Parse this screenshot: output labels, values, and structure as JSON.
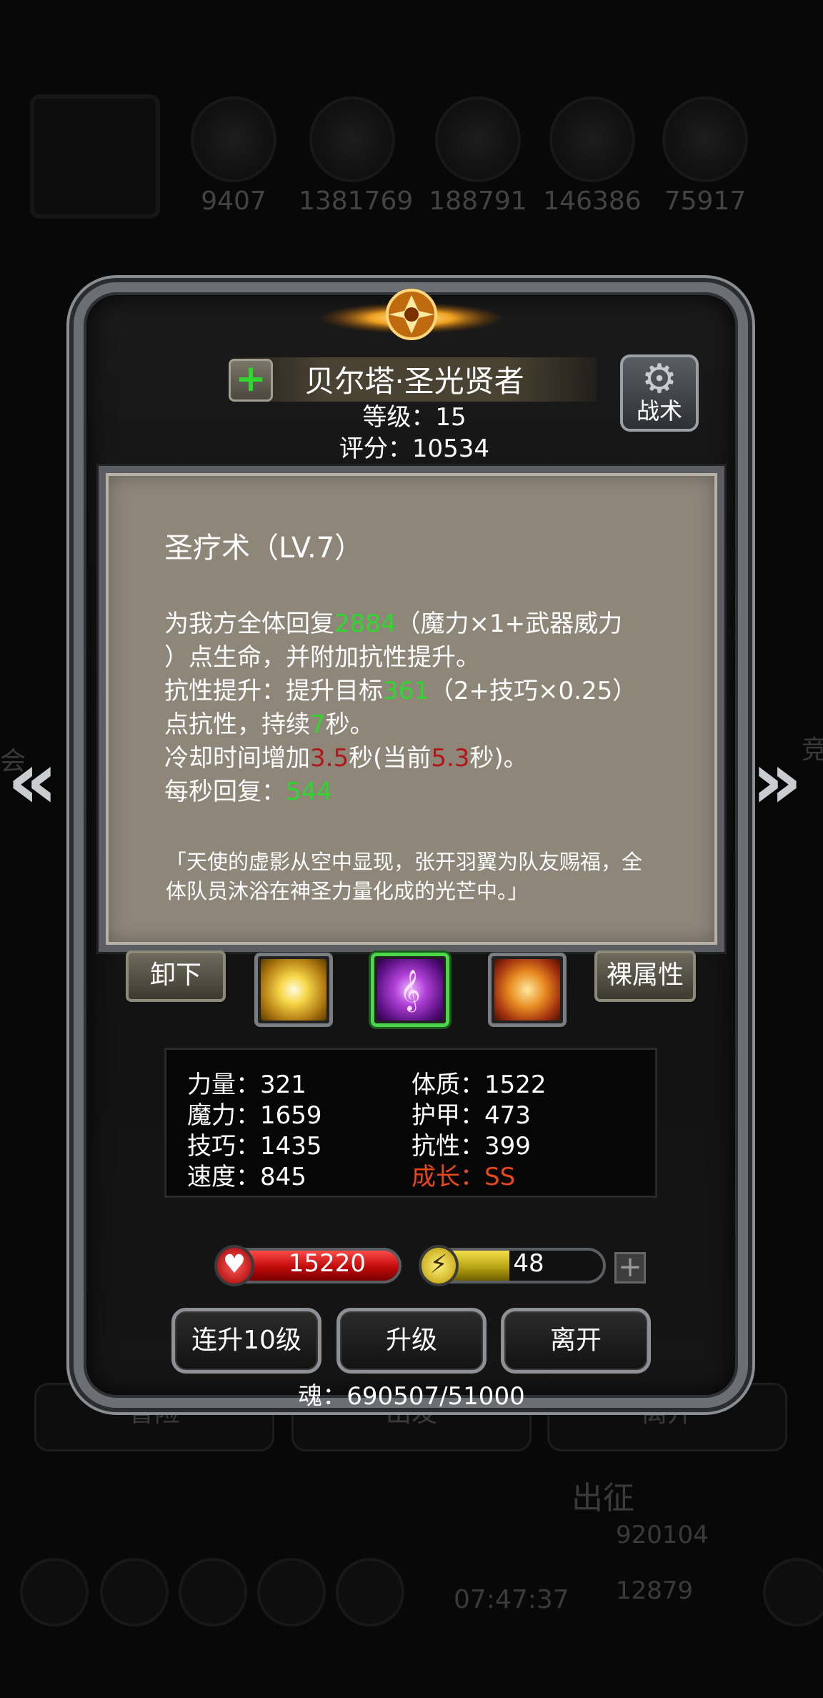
{
  "background": {
    "resources": [
      {
        "value": "9407",
        "icon": "potion-icon"
      },
      {
        "value": "1381769",
        "icon": "wood-icon"
      },
      {
        "value": "188791",
        "icon": "stone-icon"
      },
      {
        "value": "146386",
        "icon": "crystal-icon"
      },
      {
        "value": "75917",
        "icon": "ore-icon"
      }
    ],
    "tabs": [
      "冒险",
      "出发",
      "离开"
    ],
    "expedition_label": "出征",
    "gold": "920104",
    "gems": "12879",
    "timer": "07:47:37",
    "side_right": "竞",
    "side_left": "会"
  },
  "hero": {
    "name": "贝尔塔·圣光贤者",
    "level_label": "等级：15",
    "score_label": "评分：10534",
    "tactics_label": "战术"
  },
  "skill": {
    "title": "圣疗术（LV.7）",
    "line1_a": "为我方全体回复",
    "line1_v": "2884",
    "line1_b": "（魔力×1+武器威力",
    "line2": "）点生命，并附加抗性提升。",
    "line3_a": "抗性提升：提升目标",
    "line3_v": "361",
    "line3_b": "（2+技巧×0.25）",
    "line4_a": "点抗性，持续",
    "line4_v": "7",
    "line4_b": "秒。",
    "line5_a": "冷却时间增加",
    "line5_v1": "3.5",
    "line5_b": "秒(当前",
    "line5_v2": "5.3",
    "line5_c": "秒)。",
    "line6_a": "每秒回复：",
    "line6_v": "544",
    "quote": "「天使的虚影从空中显现，张开羽翼为队友赐福，全体队员沐浴在神圣力量化成的光芒中。」"
  },
  "buttons": {
    "unequip": "卸下",
    "base_attr": "裸属性",
    "upgrade10": "连升10级",
    "upgrade": "升级",
    "leave": "离开"
  },
  "stats": {
    "strength": "力量：321",
    "magic": "魔力：1659",
    "skill": "技巧：1435",
    "speed": "速度：845",
    "constitution": "体质：1522",
    "armor": "护甲：473",
    "resistance": "抗性：399",
    "growth": "成长：SS"
  },
  "bars": {
    "hp": "15220",
    "hp_fill": 1.0,
    "energy": "48",
    "energy_fill": 0.48
  },
  "soul": "魂：690507/51000",
  "colors": {
    "highlight_green": "#2ed62e",
    "highlight_red": "#b3161a",
    "growth": "#e8471a",
    "panel": "#8e8679"
  }
}
